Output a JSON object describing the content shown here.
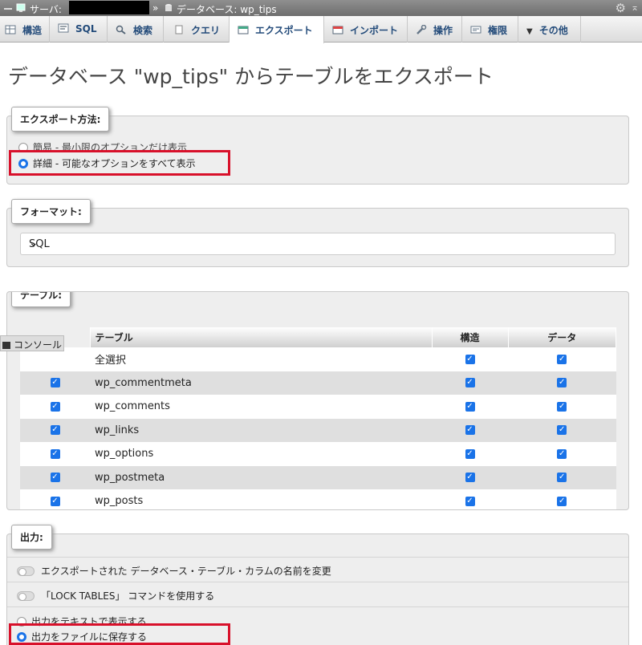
{
  "breadcrumb": {
    "server_label": "サーバ:",
    "separator": "»",
    "database_label": "データベース: wp_tips"
  },
  "tabs": [
    {
      "label": "構造",
      "icon": "structure-icon"
    },
    {
      "label": "SQL",
      "icon": "sql-icon"
    },
    {
      "label": "検索",
      "icon": "search-icon"
    },
    {
      "label": "クエリ",
      "icon": "query-icon"
    },
    {
      "label": "エクスポート",
      "icon": "export-icon",
      "active": true
    },
    {
      "label": "インポート",
      "icon": "import-icon"
    },
    {
      "label": "操作",
      "icon": "wrench-icon"
    },
    {
      "label": "権限",
      "icon": "privileges-icon"
    },
    {
      "label": "その他",
      "icon": "chevron-down-icon"
    }
  ],
  "page_title": "データベース \"wp_tips\" からテーブルをエクスポート",
  "export_method": {
    "legend": "エクスポート方法:",
    "quick_label": "簡易 - 最小限のオプションだけ表示",
    "custom_label": "詳細 - 可能なオプションをすべて表示",
    "selected": "custom"
  },
  "format": {
    "legend": "フォーマット:",
    "value": "SQL"
  },
  "tables": {
    "legend": "テーブル:",
    "headers": {
      "table": "テーブル",
      "structure": "構造",
      "data": "データ"
    },
    "select_all": "全選択",
    "rows": [
      "wp_commentmeta",
      "wp_comments",
      "wp_links",
      "wp_options",
      "wp_postmeta",
      "wp_posts"
    ]
  },
  "console": {
    "label": "コンソール"
  },
  "output": {
    "legend": "出力:",
    "rename_label": "エクスポートされた データベース・テーブル・カラムの名前を変更",
    "lock_label": "「LOCK TABLES」 コマンドを使用する",
    "as_text_label": "出力をテキストで表示する",
    "save_file_label": "出力をファイルに保存する",
    "selected": "save_file"
  },
  "colors": {
    "accent": "#1a73e8",
    "highlight": "#d8102a",
    "tab_text": "#234b7a"
  }
}
